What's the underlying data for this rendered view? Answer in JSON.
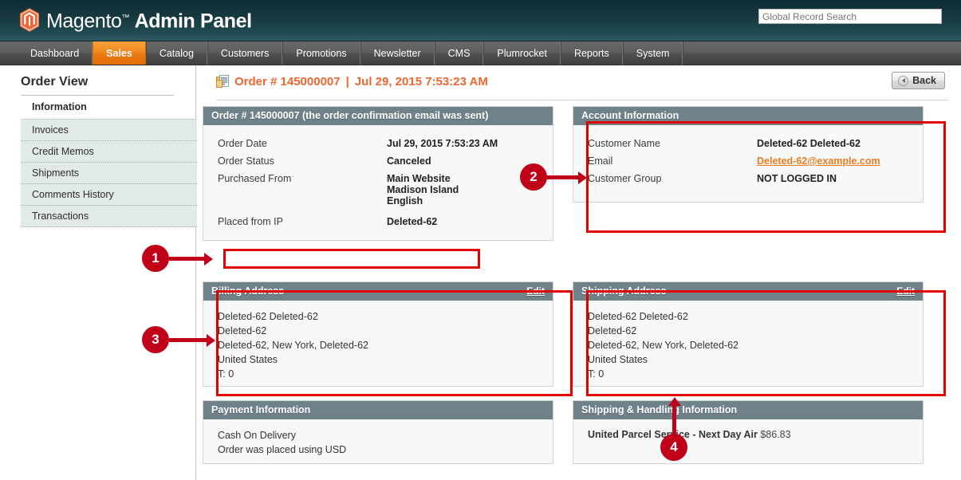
{
  "header": {
    "logo_text_main": "Magento",
    "logo_tm": "™",
    "logo_text_sub": "Admin Panel",
    "search_placeholder": "Global Record Search",
    "search_value": "Global Record Search",
    "brand_color": "#ef672f"
  },
  "nav": {
    "items": [
      {
        "label": "Dashboard",
        "active": false
      },
      {
        "label": "Sales",
        "active": true
      },
      {
        "label": "Catalog",
        "active": false
      },
      {
        "label": "Customers",
        "active": false
      },
      {
        "label": "Promotions",
        "active": false
      },
      {
        "label": "Newsletter",
        "active": false
      },
      {
        "label": "CMS",
        "active": false
      },
      {
        "label": "Plumrocket",
        "active": false
      },
      {
        "label": "Reports",
        "active": false
      },
      {
        "label": "System",
        "active": false
      }
    ]
  },
  "sidebar": {
    "title": "Order View",
    "top_item": "Information",
    "items": [
      {
        "label": "Invoices"
      },
      {
        "label": "Credit Memos"
      },
      {
        "label": "Shipments"
      },
      {
        "label": "Comments History"
      },
      {
        "label": "Transactions"
      }
    ]
  },
  "page": {
    "title_order": "Order # 145000007",
    "title_separator": "|",
    "title_date": "Jul 29, 2015 7:53:23 AM",
    "back_label": "Back"
  },
  "order_panel": {
    "heading": "Order # 145000007 (the order confirmation email was sent)",
    "rows": [
      {
        "key": "Order Date",
        "value": "Jul 29, 2015 7:53:23 AM"
      },
      {
        "key": "Order Status",
        "value": "Canceled"
      }
    ],
    "purchased_from_key": "Purchased From",
    "purchased_from_lines": [
      "Main Website",
      "Madison Island",
      "English"
    ],
    "placed_from_ip_key": "Placed from IP",
    "placed_from_ip_value": "Deleted-62"
  },
  "account_panel": {
    "heading": "Account Information",
    "rows": [
      {
        "key": "Customer Name",
        "value": "Deleted-62 Deleted-62",
        "link": false
      },
      {
        "key": "Email",
        "value": "Deleted-62@example.com",
        "link": true
      },
      {
        "key": "Customer Group",
        "value": "NOT LOGGED IN",
        "link": false
      }
    ]
  },
  "billing_panel": {
    "heading": "Billing Address",
    "edit_label": "Edit",
    "lines": [
      "Deleted-62 Deleted-62",
      "Deleted-62",
      "Deleted-62, New York, Deleted-62",
      "United States",
      "T: 0"
    ]
  },
  "shipping_panel": {
    "heading": "Shipping Address",
    "edit_label": "Edit",
    "lines": [
      "Deleted-62 Deleted-62",
      "Deleted-62",
      "Deleted-62, New York, Deleted-62",
      "United States",
      "T: 0"
    ]
  },
  "payment_panel": {
    "heading": "Payment Information",
    "lines": [
      "Cash On Delivery",
      "Order was placed using USD"
    ]
  },
  "shipping_handling_panel": {
    "heading": "Shipping & Handling Information",
    "method": "United Parcel Service - Next Day Air",
    "amount": "$86.83"
  },
  "annotations": {
    "accent_color": "#c00018",
    "markers": [
      {
        "number": "1"
      },
      {
        "number": "2"
      },
      {
        "number": "3"
      },
      {
        "number": "4"
      }
    ]
  }
}
